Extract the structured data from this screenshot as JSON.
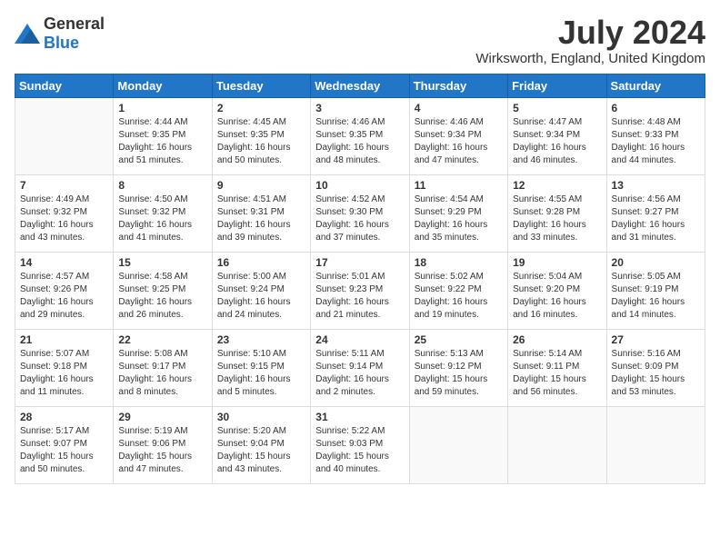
{
  "logo": {
    "general": "General",
    "blue": "Blue"
  },
  "title": {
    "month_year": "July 2024",
    "location": "Wirksworth, England, United Kingdom"
  },
  "headers": [
    "Sunday",
    "Monday",
    "Tuesday",
    "Wednesday",
    "Thursday",
    "Friday",
    "Saturday"
  ],
  "weeks": [
    [
      {
        "day": "",
        "info": ""
      },
      {
        "day": "1",
        "info": "Sunrise: 4:44 AM\nSunset: 9:35 PM\nDaylight: 16 hours\nand 51 minutes."
      },
      {
        "day": "2",
        "info": "Sunrise: 4:45 AM\nSunset: 9:35 PM\nDaylight: 16 hours\nand 50 minutes."
      },
      {
        "day": "3",
        "info": "Sunrise: 4:46 AM\nSunset: 9:35 PM\nDaylight: 16 hours\nand 48 minutes."
      },
      {
        "day": "4",
        "info": "Sunrise: 4:46 AM\nSunset: 9:34 PM\nDaylight: 16 hours\nand 47 minutes."
      },
      {
        "day": "5",
        "info": "Sunrise: 4:47 AM\nSunset: 9:34 PM\nDaylight: 16 hours\nand 46 minutes."
      },
      {
        "day": "6",
        "info": "Sunrise: 4:48 AM\nSunset: 9:33 PM\nDaylight: 16 hours\nand 44 minutes."
      }
    ],
    [
      {
        "day": "7",
        "info": "Sunrise: 4:49 AM\nSunset: 9:32 PM\nDaylight: 16 hours\nand 43 minutes."
      },
      {
        "day": "8",
        "info": "Sunrise: 4:50 AM\nSunset: 9:32 PM\nDaylight: 16 hours\nand 41 minutes."
      },
      {
        "day": "9",
        "info": "Sunrise: 4:51 AM\nSunset: 9:31 PM\nDaylight: 16 hours\nand 39 minutes."
      },
      {
        "day": "10",
        "info": "Sunrise: 4:52 AM\nSunset: 9:30 PM\nDaylight: 16 hours\nand 37 minutes."
      },
      {
        "day": "11",
        "info": "Sunrise: 4:54 AM\nSunset: 9:29 PM\nDaylight: 16 hours\nand 35 minutes."
      },
      {
        "day": "12",
        "info": "Sunrise: 4:55 AM\nSunset: 9:28 PM\nDaylight: 16 hours\nand 33 minutes."
      },
      {
        "day": "13",
        "info": "Sunrise: 4:56 AM\nSunset: 9:27 PM\nDaylight: 16 hours\nand 31 minutes."
      }
    ],
    [
      {
        "day": "14",
        "info": "Sunrise: 4:57 AM\nSunset: 9:26 PM\nDaylight: 16 hours\nand 29 minutes."
      },
      {
        "day": "15",
        "info": "Sunrise: 4:58 AM\nSunset: 9:25 PM\nDaylight: 16 hours\nand 26 minutes."
      },
      {
        "day": "16",
        "info": "Sunrise: 5:00 AM\nSunset: 9:24 PM\nDaylight: 16 hours\nand 24 minutes."
      },
      {
        "day": "17",
        "info": "Sunrise: 5:01 AM\nSunset: 9:23 PM\nDaylight: 16 hours\nand 21 minutes."
      },
      {
        "day": "18",
        "info": "Sunrise: 5:02 AM\nSunset: 9:22 PM\nDaylight: 16 hours\nand 19 minutes."
      },
      {
        "day": "19",
        "info": "Sunrise: 5:04 AM\nSunset: 9:20 PM\nDaylight: 16 hours\nand 16 minutes."
      },
      {
        "day": "20",
        "info": "Sunrise: 5:05 AM\nSunset: 9:19 PM\nDaylight: 16 hours\nand 14 minutes."
      }
    ],
    [
      {
        "day": "21",
        "info": "Sunrise: 5:07 AM\nSunset: 9:18 PM\nDaylight: 16 hours\nand 11 minutes."
      },
      {
        "day": "22",
        "info": "Sunrise: 5:08 AM\nSunset: 9:17 PM\nDaylight: 16 hours\nand 8 minutes."
      },
      {
        "day": "23",
        "info": "Sunrise: 5:10 AM\nSunset: 9:15 PM\nDaylight: 16 hours\nand 5 minutes."
      },
      {
        "day": "24",
        "info": "Sunrise: 5:11 AM\nSunset: 9:14 PM\nDaylight: 16 hours\nand 2 minutes."
      },
      {
        "day": "25",
        "info": "Sunrise: 5:13 AM\nSunset: 9:12 PM\nDaylight: 15 hours\nand 59 minutes."
      },
      {
        "day": "26",
        "info": "Sunrise: 5:14 AM\nSunset: 9:11 PM\nDaylight: 15 hours\nand 56 minutes."
      },
      {
        "day": "27",
        "info": "Sunrise: 5:16 AM\nSunset: 9:09 PM\nDaylight: 15 hours\nand 53 minutes."
      }
    ],
    [
      {
        "day": "28",
        "info": "Sunrise: 5:17 AM\nSunset: 9:07 PM\nDaylight: 15 hours\nand 50 minutes."
      },
      {
        "day": "29",
        "info": "Sunrise: 5:19 AM\nSunset: 9:06 PM\nDaylight: 15 hours\nand 47 minutes."
      },
      {
        "day": "30",
        "info": "Sunrise: 5:20 AM\nSunset: 9:04 PM\nDaylight: 15 hours\nand 43 minutes."
      },
      {
        "day": "31",
        "info": "Sunrise: 5:22 AM\nSunset: 9:03 PM\nDaylight: 15 hours\nand 40 minutes."
      },
      {
        "day": "",
        "info": ""
      },
      {
        "day": "",
        "info": ""
      },
      {
        "day": "",
        "info": ""
      }
    ]
  ]
}
